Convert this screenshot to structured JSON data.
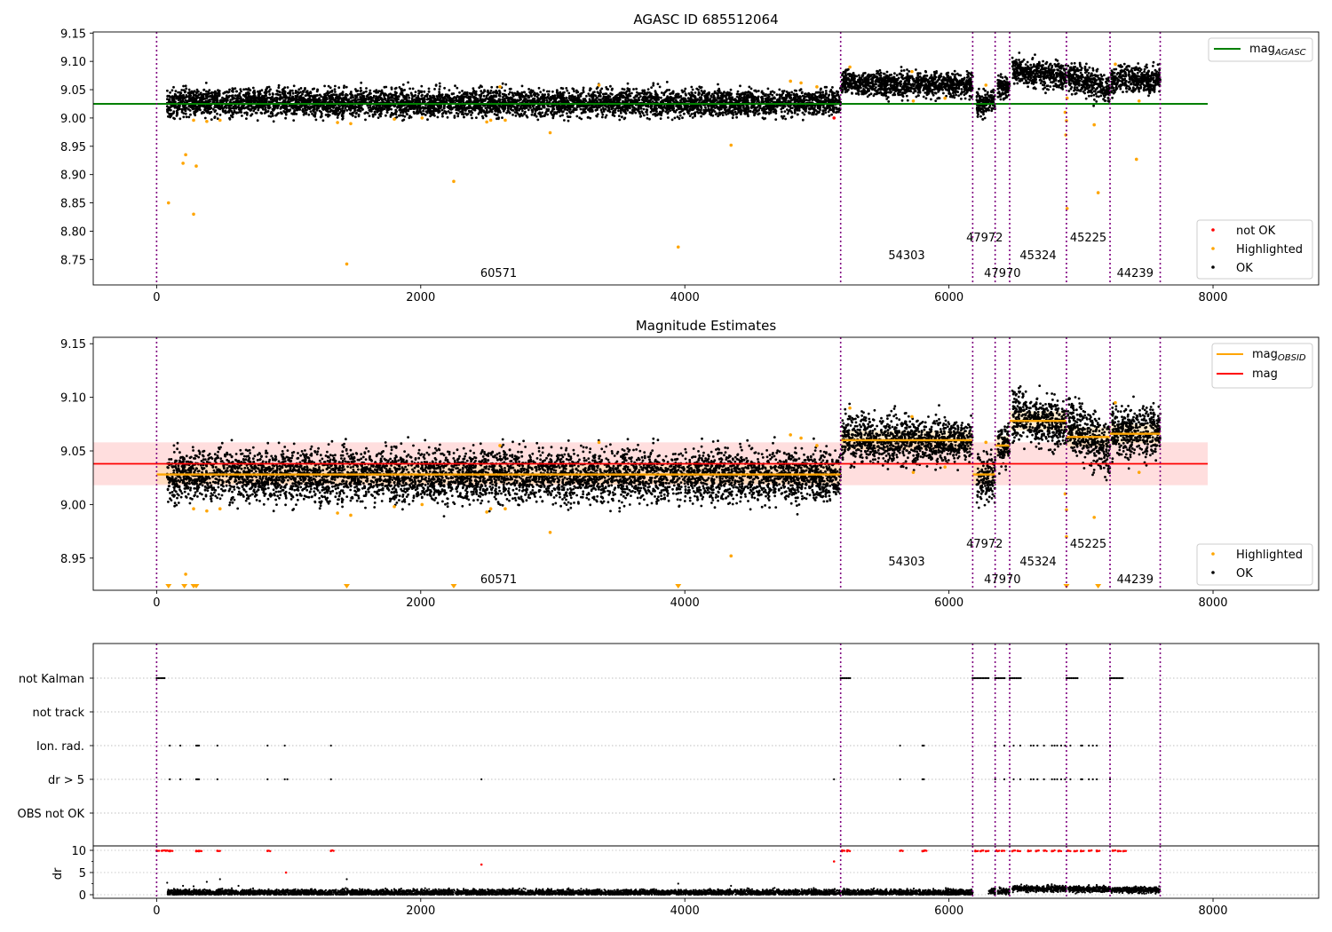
{
  "figure": {
    "x_ticks": [
      0,
      2000,
      4000,
      6000,
      8000
    ],
    "xlim": [
      -480,
      8800
    ],
    "obsid_boundaries": [
      0,
      5180,
      6180,
      6350,
      6460,
      6890,
      7220,
      7600
    ],
    "obsid_labels": [
      {
        "text": "60571",
        "x": 2590,
        "row": 2
      },
      {
        "text": "54303",
        "x": 5680,
        "row": 1
      },
      {
        "text": "47972",
        "x": 6270,
        "row": 0
      },
      {
        "text": "47970",
        "x": 6405,
        "row": 2
      },
      {
        "text": "45324",
        "x": 6675,
        "row": 1
      },
      {
        "text": "45225",
        "x": 7055,
        "row": 0
      },
      {
        "text": "44239",
        "x": 7410,
        "row": 2
      }
    ],
    "colors": {
      "ok": "#000000",
      "highlighted": "#ffa500",
      "not_ok": "#ff0000",
      "boundary": "#800080",
      "agasc_line": "#008000",
      "mag_line": "#ff0000",
      "obsid_line": "#ffa500",
      "band": "#ffcccc"
    }
  },
  "chart_data": [
    {
      "type": "scatter",
      "title": "AGASC ID 685512064",
      "ylim": [
        8.705,
        9.152
      ],
      "y_ticks": [
        "8.75",
        "8.80",
        "8.85",
        "8.90",
        "8.95",
        "9.00",
        "9.05",
        "9.10",
        "9.15"
      ],
      "legend_top": [
        {
          "label": "mag",
          "sub": "AGASC",
          "color": "#008000"
        }
      ],
      "legend_bottom": [
        {
          "label": "not OK",
          "color": "#ff0000"
        },
        {
          "label": "Highlighted",
          "color": "#ffa500"
        },
        {
          "label": "OK",
          "color": "#000000"
        }
      ],
      "mag_agasc": 9.025,
      "mag_agasc_x_range": [
        -480,
        7960
      ],
      "ok_segments": [
        {
          "x": [
            80,
            5180
          ],
          "y0": 9.027,
          "y1": 9.027,
          "spread": 0.012
        },
        {
          "x": [
            5190,
            6180
          ],
          "y0": 9.062,
          "y1": 9.058,
          "spread": 0.011
        },
        {
          "x": [
            6210,
            6350
          ],
          "y0": 9.025,
          "y1": 9.025,
          "spread": 0.012
        },
        {
          "x": [
            6370,
            6460
          ],
          "y0": 9.055,
          "y1": 9.055,
          "spread": 0.01
        },
        {
          "x": [
            6480,
            6890
          ],
          "y0": 9.085,
          "y1": 9.072,
          "spread": 0.012
        },
        {
          "x": [
            6900,
            7220
          ],
          "y0": 9.075,
          "y1": 9.052,
          "spread": 0.013
        },
        {
          "x": [
            7230,
            7600
          ],
          "y0": 9.068,
          "y1": 9.068,
          "spread": 0.012
        }
      ],
      "highlighted_points": [
        [
          90,
          8.85
        ],
        [
          200,
          8.92
        ],
        [
          220,
          8.935
        ],
        [
          280,
          8.83
        ],
        [
          300,
          8.915
        ],
        [
          280,
          8.996
        ],
        [
          380,
          8.994
        ],
        [
          480,
          8.996
        ],
        [
          1440,
          8.742
        ],
        [
          1370,
          8.992
        ],
        [
          1470,
          8.99
        ],
        [
          1800,
          8.998
        ],
        [
          2010,
          9.0
        ],
        [
          2250,
          8.888
        ],
        [
          2500,
          8.993
        ],
        [
          2530,
          8.996
        ],
        [
          2600,
          9.055
        ],
        [
          2640,
          8.996
        ],
        [
          2980,
          8.974
        ],
        [
          3350,
          9.058
        ],
        [
          3950,
          8.772
        ],
        [
          4350,
          8.952
        ],
        [
          4800,
          9.065
        ],
        [
          4880,
          9.062
        ],
        [
          5000,
          9.055
        ],
        [
          5250,
          9.09
        ],
        [
          5720,
          9.082
        ],
        [
          5730,
          9.03
        ],
        [
          5970,
          9.035
        ],
        [
          6280,
          9.058
        ],
        [
          6880,
          9.01
        ],
        [
          6885,
          8.97
        ],
        [
          6890,
          8.995
        ],
        [
          6895,
          8.84
        ],
        [
          6895,
          9.035
        ],
        [
          7100,
          8.988
        ],
        [
          7130,
          8.868
        ],
        [
          7260,
          9.095
        ],
        [
          7420,
          8.927
        ],
        [
          7440,
          9.03
        ]
      ],
      "not_ok_points": [
        [
          5130,
          9.0
        ]
      ]
    },
    {
      "type": "scatter",
      "title": "Magnitude Estimates",
      "ylim": [
        8.92,
        9.156
      ],
      "y_ticks": [
        "8.95",
        "9.00",
        "9.05",
        "9.10",
        "9.15"
      ],
      "legend_top": [
        {
          "label": "mag",
          "sub": "OBSID",
          "color": "#ffa500"
        },
        {
          "label": "mag",
          "sub": "",
          "color": "#ff0000"
        }
      ],
      "legend_bottom": [
        {
          "label": "Highlighted",
          "color": "#ffa500"
        },
        {
          "label": "OK",
          "color": "#000000"
        }
      ],
      "mag": 9.038,
      "mag_band": [
        9.018,
        9.058
      ],
      "mag_x_range": [
        -480,
        7960
      ],
      "mag_obsid": [
        {
          "x": [
            0,
            5180
          ],
          "y": 9.028
        },
        {
          "x": [
            5180,
            6180
          ],
          "y": 9.06
        },
        {
          "x": [
            6180,
            6350
          ],
          "y": 9.028
        },
        {
          "x": [
            6350,
            6460
          ],
          "y": 9.055
        },
        {
          "x": [
            6460,
            6890
          ],
          "y": 9.078
        },
        {
          "x": [
            6890,
            7220
          ],
          "y": 9.063
        },
        {
          "x": [
            7220,
            7600
          ],
          "y": 9.066
        }
      ],
      "below_markers_x": [
        90,
        210,
        280,
        300,
        1440,
        2250,
        3950,
        6890,
        7130
      ],
      "highlighted_points": [
        [
          280,
          8.996
        ],
        [
          380,
          8.994
        ],
        [
          480,
          8.996
        ],
        [
          220,
          8.935
        ],
        [
          1370,
          8.992
        ],
        [
          1470,
          8.99
        ],
        [
          1800,
          8.998
        ],
        [
          2010,
          9.0
        ],
        [
          2500,
          8.993
        ],
        [
          2530,
          8.996
        ],
        [
          2600,
          9.055
        ],
        [
          2640,
          8.996
        ],
        [
          2980,
          8.974
        ],
        [
          3350,
          9.058
        ],
        [
          4350,
          8.952
        ],
        [
          4800,
          9.065
        ],
        [
          4880,
          9.062
        ],
        [
          5000,
          9.055
        ],
        [
          5250,
          9.09
        ],
        [
          5720,
          9.082
        ],
        [
          5730,
          9.03
        ],
        [
          5970,
          9.035
        ],
        [
          6280,
          9.058
        ],
        [
          6880,
          9.01
        ],
        [
          6890,
          8.995
        ],
        [
          6890,
          8.97
        ],
        [
          7100,
          8.988
        ],
        [
          7260,
          9.095
        ],
        [
          7440,
          9.03
        ]
      ]
    },
    {
      "type": "scatter",
      "title": "",
      "flag_labels": [
        "not Kalman",
        "not track",
        "Ion. rad.",
        "dr > 5",
        "OBS not OK"
      ],
      "dr_ylabel": "dr",
      "dr_ylim": [
        -0.8,
        11
      ],
      "dr_ticks": [
        "0",
        "5",
        "10"
      ],
      "flag_points": {
        "not Kalman": [
          [
            0,
            70
          ],
          [
            5180,
            5260
          ],
          [
            6180,
            6300
          ],
          [
            6350,
            6430
          ],
          [
            6460,
            6550
          ],
          [
            6890,
            6980
          ],
          [
            7220,
            7320
          ]
        ],
        "not track": [],
        "Ion. rad.": [
          100,
          180,
          300,
          310,
          320,
          460,
          840,
          970,
          1320,
          5630,
          5800,
          5810,
          6350,
          6420,
          6490,
          6540,
          6620,
          6640,
          6670,
          6720,
          6780,
          6800,
          6820,
          6850,
          6880,
          6920,
          7000,
          7010,
          7060,
          7090,
          7120,
          7220
        ],
        "dr > 5": [
          100,
          180,
          300,
          310,
          320,
          460,
          840,
          970,
          990,
          1320,
          2460,
          5130,
          5630,
          5800,
          5810,
          6350,
          6420,
          6490,
          6540,
          6620,
          6640,
          6670,
          6720,
          6780,
          6800,
          6820,
          6850,
          6880,
          6920,
          7000,
          7010,
          7060,
          7090,
          7120,
          7220
        ],
        "OBS not OK": []
      },
      "dr_not_ok": [
        [
          0,
          9.9
        ],
        [
          40,
          9.9
        ],
        [
          70,
          9.9
        ],
        [
          100,
          9.8
        ],
        [
          300,
          9.8
        ],
        [
          320,
          9.8
        ],
        [
          460,
          9.9
        ],
        [
          840,
          9.9
        ],
        [
          980,
          5.0
        ],
        [
          1320,
          9.9
        ],
        [
          2460,
          6.8
        ],
        [
          5130,
          7.5
        ],
        [
          5190,
          9.8
        ],
        [
          5230,
          9.8
        ],
        [
          5630,
          9.9
        ],
        [
          5800,
          9.8
        ],
        [
          5810,
          9.9
        ],
        [
          6200,
          9.8
        ],
        [
          6240,
          9.8
        ],
        [
          6280,
          9.8
        ],
        [
          6360,
          9.9
        ],
        [
          6400,
          9.9
        ],
        [
          6480,
          9.8
        ],
        [
          6520,
          9.9
        ],
        [
          6600,
          9.8
        ],
        [
          6660,
          9.8
        ],
        [
          6720,
          9.9
        ],
        [
          6780,
          9.8
        ],
        [
          6830,
          9.8
        ],
        [
          6900,
          9.9
        ],
        [
          6950,
          9.8
        ],
        [
          7000,
          9.8
        ],
        [
          7060,
          9.9
        ],
        [
          7120,
          9.8
        ],
        [
          7240,
          9.9
        ],
        [
          7280,
          9.8
        ],
        [
          7320,
          9.8
        ]
      ],
      "dr_ok_extra": [
        [
          80,
          2.7
        ],
        [
          200,
          2.0
        ],
        [
          280,
          1.9
        ],
        [
          380,
          2.9
        ],
        [
          480,
          3.5
        ],
        [
          620,
          2.0
        ],
        [
          1440,
          3.5
        ],
        [
          3950,
          2.5
        ],
        [
          4350,
          2.0
        ]
      ],
      "dr_ok_segments": [
        {
          "x": [
            80,
            5180
          ],
          "level": 0.5
        },
        {
          "x": [
            5190,
            6180
          ],
          "level": 0.5
        },
        {
          "x": [
            6300,
            6350
          ],
          "level": 0.8
        },
        {
          "x": [
            6370,
            6460
          ],
          "level": 0.8
        },
        {
          "x": [
            6480,
            6890
          ],
          "level": 1.4
        },
        {
          "x": [
            6900,
            7220
          ],
          "level": 1.2
        },
        {
          "x": [
            7230,
            7600
          ],
          "level": 1.1
        }
      ]
    }
  ]
}
